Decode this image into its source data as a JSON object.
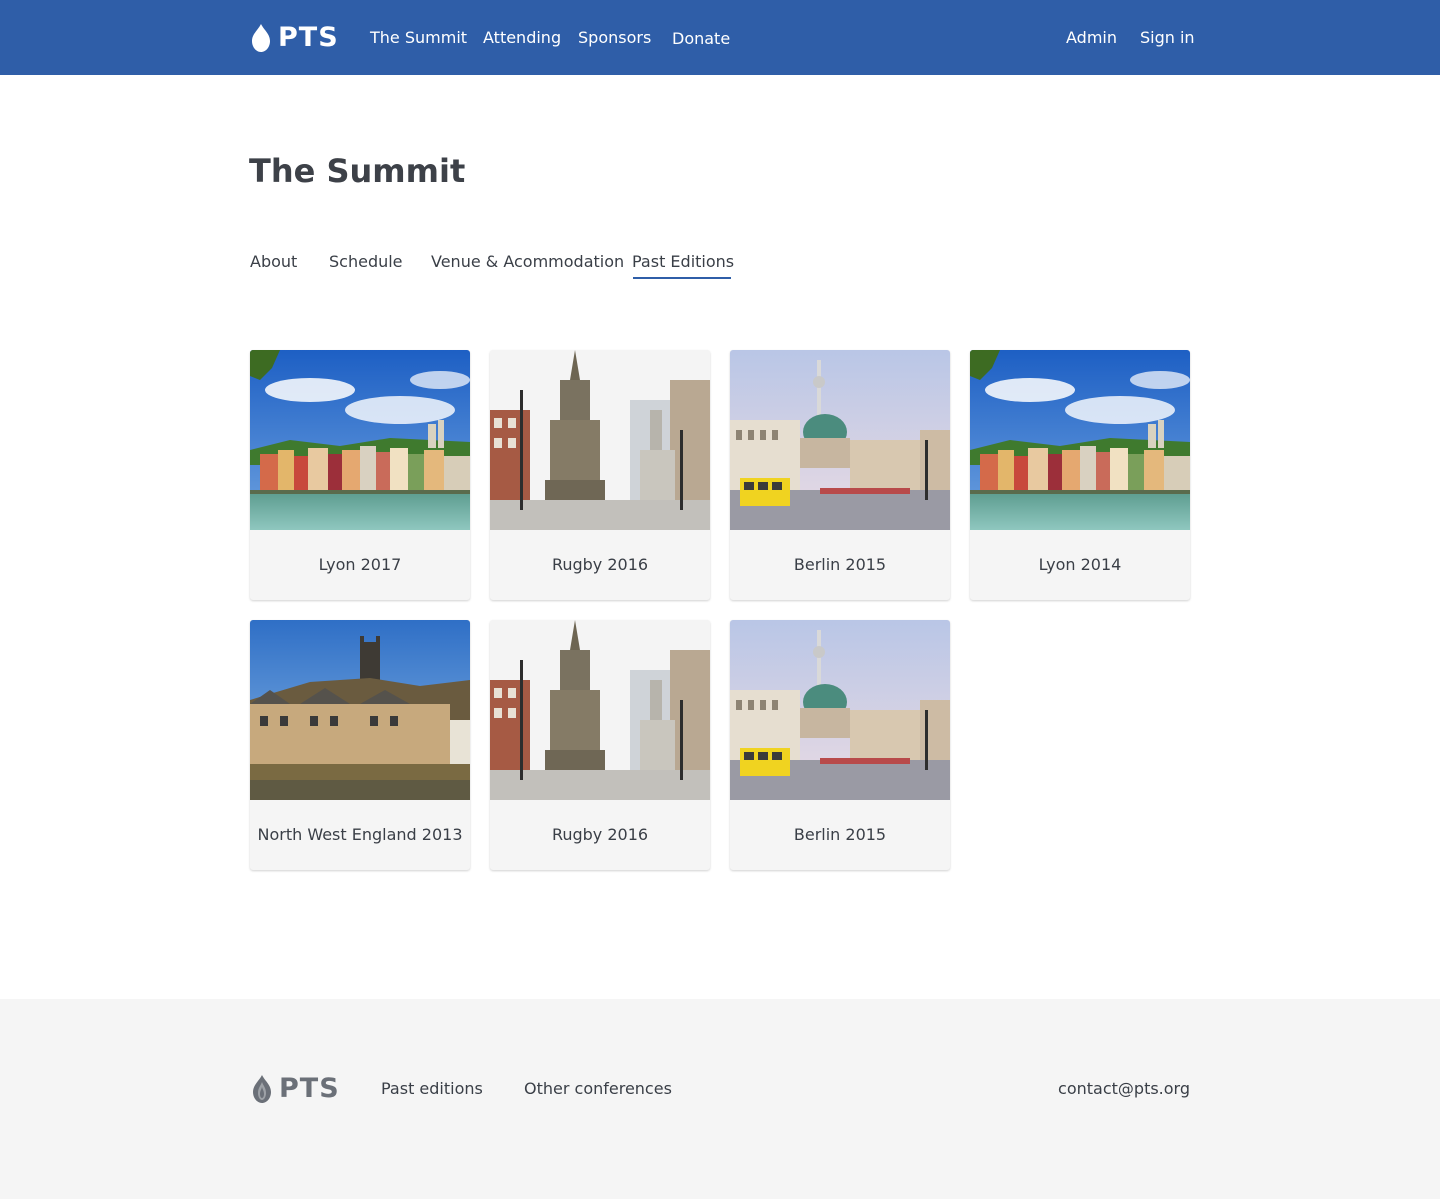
{
  "header": {
    "logo_text": "PTS",
    "nav": {
      "summit": "The Summit",
      "attending": "Attending",
      "sponsors": "Sponsors",
      "donate": "Donate"
    },
    "admin": "Admin",
    "sign_in": "Sign in"
  },
  "page": {
    "title": "The Summit",
    "tabs": {
      "about": "About",
      "schedule": "Schedule",
      "venue": "Venue & Acommodation",
      "past": "Past Editions"
    },
    "active_tab": "Past Editions"
  },
  "editions": [
    {
      "label": "Lyon 2017",
      "image": "lyon-waterfront"
    },
    {
      "label": "Rugby 2016",
      "image": "rugby-monument"
    },
    {
      "label": "Berlin 2015",
      "image": "berlin-street"
    },
    {
      "label": "Lyon 2014",
      "image": "lyon-waterfront"
    },
    {
      "label": "North West England 2013",
      "image": "northwest-england-castle"
    },
    {
      "label": "Rugby 2016",
      "image": "rugby-monument"
    },
    {
      "label": "Berlin 2015",
      "image": "berlin-street"
    }
  ],
  "footer": {
    "logo_text": "PTS",
    "past_editions": "Past editions",
    "other_conferences": "Other conferences",
    "contact": "contact@pts.org"
  },
  "colors": {
    "brand_blue": "#2f5ea8",
    "footer_bg": "#f5f5f5",
    "card_bg": "#f5f5f5",
    "text": "#3a3f47"
  }
}
